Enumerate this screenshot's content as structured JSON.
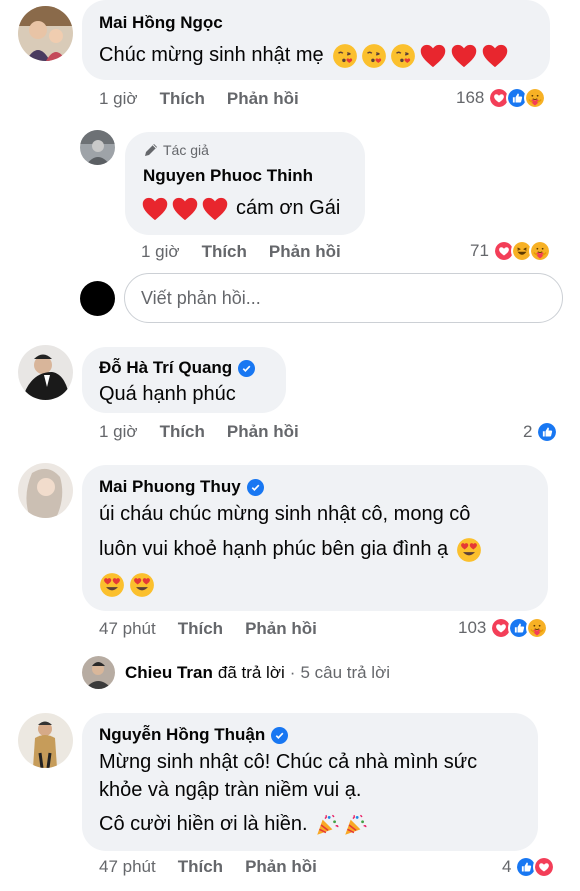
{
  "comments": {
    "c1": {
      "author": "Mai Hồng Ngọc",
      "text": "Chúc mừng sinh nhật mẹ",
      "time": "1 giờ",
      "like": "Thích",
      "reply": "Phản hồi",
      "reaction_count": "168"
    },
    "r1": {
      "badge": "Tác giả",
      "author": "Nguyen Phuoc Thinh",
      "text": "cám ơn Gái",
      "time": "1 giờ",
      "like": "Thích",
      "reply": "Phản hồi",
      "reaction_count": "71"
    },
    "reply_box": {
      "placeholder": "Viết phản hồi..."
    },
    "c2": {
      "author": "Đỗ Hà Trí Quang",
      "text": "Quá hạnh phúc",
      "time": "1 giờ",
      "like": "Thích",
      "reply": "Phản hồi",
      "reaction_count": "2"
    },
    "c3": {
      "author": "Mai Phuong Thuy",
      "line1": "úi cháu chúc mừng sinh nhật cô, mong cô",
      "line2": "luôn vui khoẻ hạnh phúc bên gia đình ạ",
      "time": "47 phút",
      "like": "Thích",
      "reply": "Phản hồi",
      "reaction_count": "103"
    },
    "replies_summary": {
      "author": "Chieu Tran",
      "action": "đã trả lời",
      "separator": "·",
      "count": "5 câu trả lời"
    },
    "c4": {
      "author": "Nguyễn Hồng Thuận",
      "line1": "Mừng sinh nhật cô! Chúc cả nhà mình sức",
      "line2": "khỏe và ngập tràn niềm vui ạ.",
      "line3": "Cô cười hiền ơi là hiền.",
      "time": "47 phút",
      "like": "Thích",
      "reply": "Phản hồi",
      "reaction_count": "4"
    }
  },
  "colors": {
    "like_blue": "#1877f2",
    "love_red": "#f33e58",
    "haha_yellow": "#f7b125",
    "bubble_gray": "#f0f2f5",
    "meta_gray": "#65676b"
  }
}
